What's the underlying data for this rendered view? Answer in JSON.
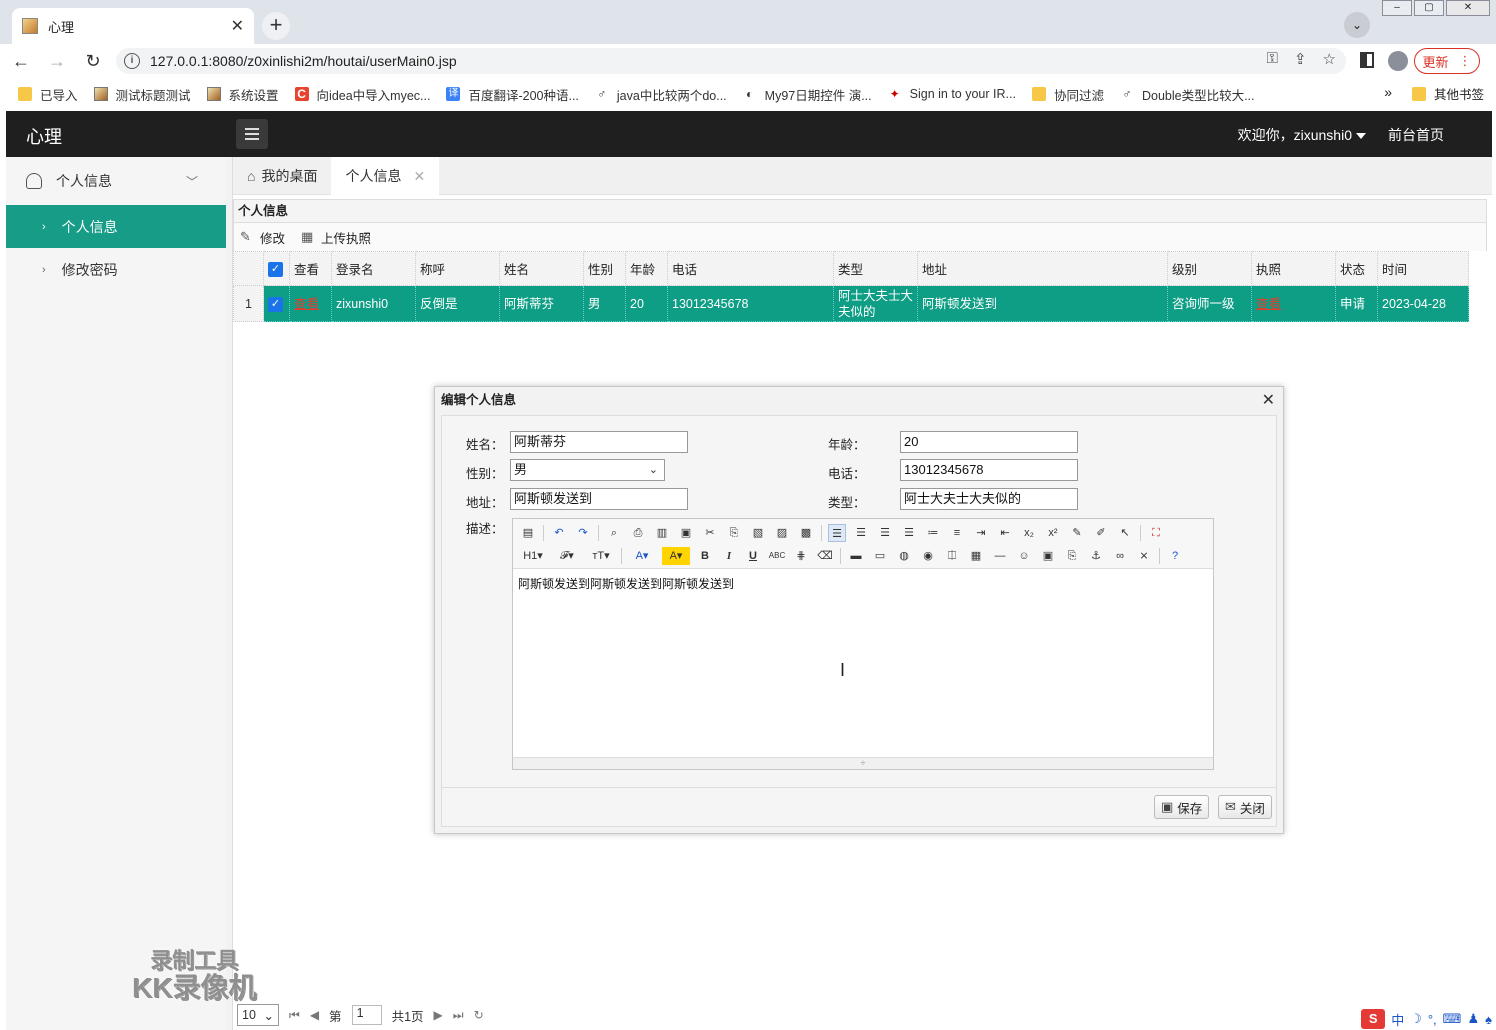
{
  "browser": {
    "tab_title": "心理",
    "url": "127.0.0.1:8080/z0xinlishi2m/houtai/userMain0.jsp",
    "update_label": "更新",
    "bookmarks": [
      "已导入",
      "测试标题测试",
      "系统设置",
      "向idea中导入myec...",
      "百度翻译-200种语...",
      "java中比较两个do...",
      "My97日期控件 演...",
      "Sign in to your IR...",
      "协同过滤",
      "Double类型比较大..."
    ],
    "other_bookmarks": "其他书签",
    "more": "»"
  },
  "app": {
    "logo": "心理",
    "welcome": "欢迎你，zixunshi0",
    "front_link": "前台首页"
  },
  "sidebar": {
    "group": "个人信息",
    "items": [
      {
        "label": "个人信息",
        "active": true
      },
      {
        "label": "修改密码",
        "active": false
      }
    ]
  },
  "tabs": {
    "desktop": "我的桌面",
    "current": "个人信息"
  },
  "panel": {
    "title": "个人信息",
    "edit_label": "修改",
    "upload_label": "上传执照"
  },
  "grid": {
    "headers": [
      "查看",
      "登录名",
      "称呼",
      "姓名",
      "性别",
      "年龄",
      "电话",
      "类型",
      "地址",
      "级别",
      "执照",
      "状态",
      "时间"
    ],
    "rows": [
      {
        "rownum": "1",
        "view": "查看",
        "login": "zixunshi0",
        "nickname": "反倒是",
        "name": "阿斯蒂芬",
        "gender": "男",
        "age": "20",
        "phone": "13012345678",
        "type": "阿士大夫士大夫似的",
        "address": "阿斯顿发送到",
        "level": "咨询师一级",
        "license": "查看",
        "status": "申请",
        "time": "2023-04-28"
      }
    ]
  },
  "pager": {
    "page_size": "10",
    "page_prefix": "第",
    "page_value": "1",
    "total": "共1页"
  },
  "dialog": {
    "title": "编辑个人信息",
    "labels": {
      "name": "姓名：",
      "gender": "性别：",
      "address": "地址：",
      "description": "描述：",
      "age": "年龄：",
      "phone": "电话：",
      "type": "类型："
    },
    "values": {
      "name": "阿斯蒂芬",
      "gender": "男",
      "address": "阿斯顿发送到",
      "age": "20",
      "phone": "13012345678",
      "type": "阿士大夫士大夫似的"
    },
    "editor_content": "阿斯顿发送到阿斯顿发送到阿斯顿发送到",
    "save_label": "保存",
    "close_label": "关闭"
  },
  "watermark": {
    "line1": "录制工具",
    "line2": "KK录像机"
  },
  "tray": {
    "ime": "中"
  },
  "colors": {
    "accent": "#169c87",
    "header": "#1f1f1f",
    "link_red": "#e63b2e"
  }
}
